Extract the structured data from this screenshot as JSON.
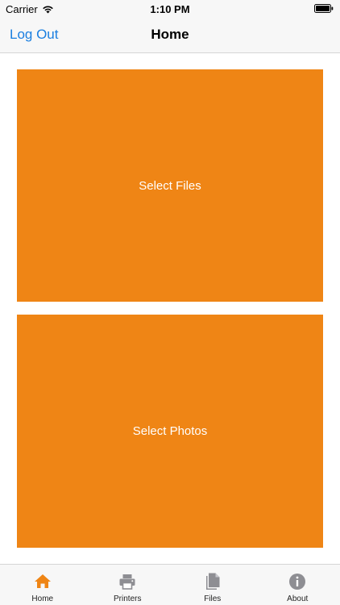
{
  "status_bar": {
    "carrier": "Carrier",
    "time": "1:10 PM"
  },
  "nav_bar": {
    "left_button": "Log Out",
    "title": "Home"
  },
  "tiles": {
    "files_label": "Select Files",
    "photos_label": "Select Photos"
  },
  "tab_bar": {
    "items": [
      {
        "label": "Home",
        "icon": "home-icon"
      },
      {
        "label": "Printers",
        "icon": "printer-icon"
      },
      {
        "label": "Files",
        "icon": "files-icon"
      },
      {
        "label": "About",
        "icon": "info-icon"
      }
    ],
    "selected": "Home"
  },
  "colors": {
    "accent": "#ef8515",
    "link": "#1a7fe0",
    "inactive_icon": "#8e8e93"
  }
}
